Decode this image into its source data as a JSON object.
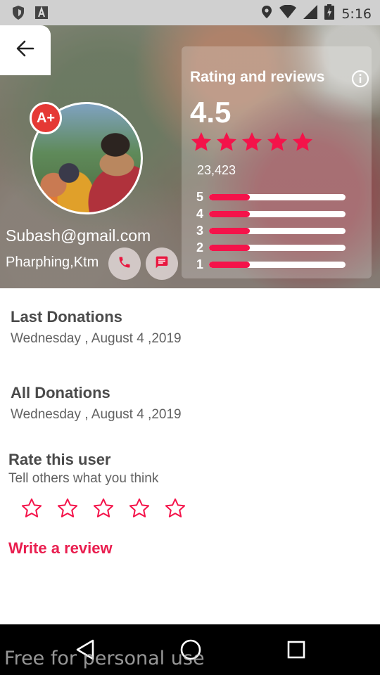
{
  "status_bar": {
    "time": "5:16",
    "left_icons": [
      "shield-icon",
      "a-icon"
    ],
    "right_icons": [
      "location-icon",
      "wifi-icon",
      "signal-icon",
      "battery-charging-icon"
    ]
  },
  "header": {
    "back_icon": "arrow-left-icon"
  },
  "profile": {
    "blood_group": "A+",
    "email": "Subash@gmail.com",
    "location": "Pharphing,Ktm",
    "call_icon": "phone-icon",
    "message_icon": "message-icon"
  },
  "rating": {
    "title": "Rating and reviews",
    "info_icon": "info-icon",
    "score": "4.5",
    "stars": 5,
    "count": "23,423",
    "bars": [
      {
        "label": "5",
        "fraction": 0.3
      },
      {
        "label": "4",
        "fraction": 0.3
      },
      {
        "label": "3",
        "fraction": 0.3
      },
      {
        "label": "2",
        "fraction": 0.3
      },
      {
        "label": "1",
        "fraction": 0.3
      }
    ]
  },
  "last_donations": {
    "heading": "Last Donations",
    "date": "Wednesday , August 4 ,2019"
  },
  "all_donations": {
    "heading": "All Donations",
    "date": "Wednesday , August 4 ,2019"
  },
  "rate_user": {
    "heading": "Rate this user",
    "subtitle": "Tell others what you think",
    "stars": 5,
    "write_review": "Write a review"
  },
  "nav_bar": {
    "icons": [
      "back-triangle-icon",
      "home-circle-icon",
      "recents-square-icon"
    ]
  },
  "watermark": "Free for personal use",
  "colors": {
    "accent": "#f4134a",
    "review_link": "#e91e4f",
    "badge": "#e53935"
  }
}
